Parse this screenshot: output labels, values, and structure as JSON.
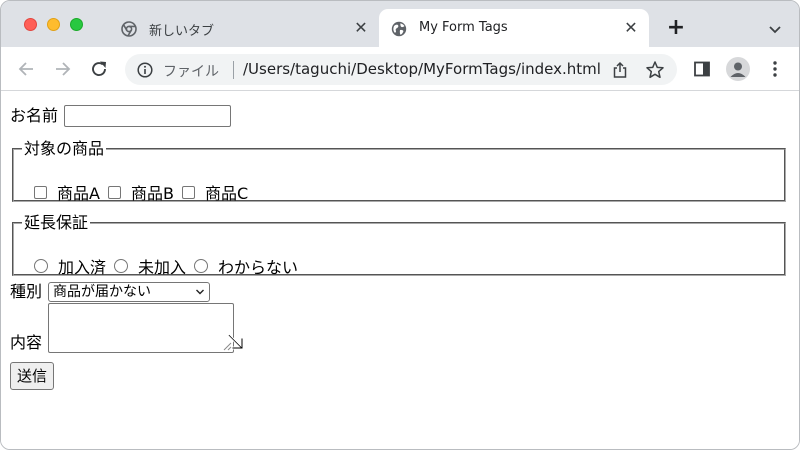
{
  "window": {
    "traffic_lights": [
      "close",
      "minimize",
      "zoom"
    ]
  },
  "tabs": [
    {
      "title": "新しいタブ",
      "icon": "chrome-icon",
      "active": false
    },
    {
      "title": "My Form Tags",
      "icon": "globe-icon",
      "active": true
    }
  ],
  "toolbar": {
    "scheme_label": "ファイル",
    "url": "/Users/taguchi/Desktop/MyFormTags/index.html"
  },
  "form": {
    "name_label": "お名前",
    "name_value": "",
    "products": {
      "legend": "対象の商品",
      "options": [
        {
          "label": "商品A",
          "checked": false
        },
        {
          "label": "商品B",
          "checked": false
        },
        {
          "label": "商品C",
          "checked": false
        }
      ]
    },
    "warranty": {
      "legend": "延長保証",
      "options": [
        {
          "label": "加入済",
          "selected": false
        },
        {
          "label": "未加入",
          "selected": false
        },
        {
          "label": "わからない",
          "selected": false
        }
      ]
    },
    "kind_label": "種別",
    "kind_selected": "商品が届かない",
    "content_label": "内容",
    "content_value": "",
    "submit_label": "送信"
  },
  "colors": {
    "tabstrip_bg": "#dee1e6",
    "omnibox_bg": "#f1f3f4",
    "traffic_red": "#ff5f57",
    "traffic_yellow": "#febc2e",
    "traffic_green": "#28c840"
  }
}
